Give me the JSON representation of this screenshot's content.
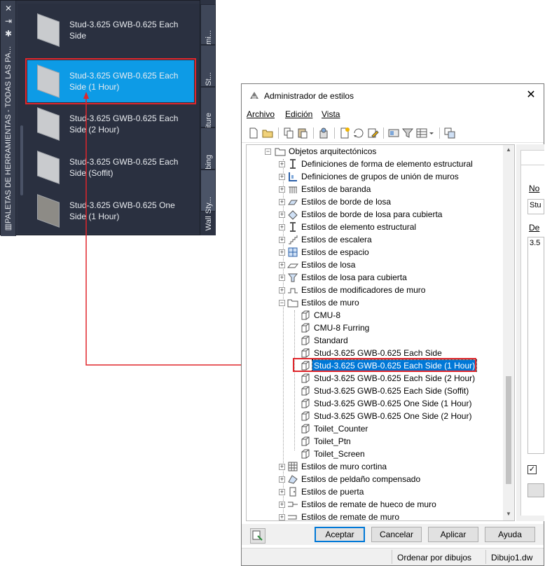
{
  "palette": {
    "title": "PALETAS DE HERRAMIENTAS - TODAS LAS PA...",
    "controls": [
      "close-icon",
      "autohide-icon",
      "properties-icon"
    ],
    "items": [
      {
        "label_line1": "Stud-3.625 GWB-0.625 Each",
        "label_line2": "Side"
      },
      {
        "label_line1": "Stud-3.625 GWB-0.625 Each",
        "label_line2": "Side (1 Hour)"
      },
      {
        "label_line1": "Stud-3.625 GWB-0.625 Each",
        "label_line2": "Side (2 Hour)"
      },
      {
        "label_line1": "Stud-3.625 GWB-0.625 Each",
        "label_line2": "Side (Soffit)"
      },
      {
        "label_line1": "Stud-3.625 GWB-0.625 One",
        "label_line2": "Side (1 Hour)"
      }
    ],
    "selected_index": 1,
    "tabs": [
      "Herrami...",
      "Door St...",
      "Furniture",
      "Plumbing",
      "Wall Sty..."
    ]
  },
  "dialog": {
    "title": "Administrador de estilos",
    "close_glyph": "✕",
    "menu": [
      "Archivo",
      "Edición",
      "Vista"
    ],
    "tree": {
      "root": "Objetos arquitectónicos",
      "categories": [
        "Definiciones de forma de elemento estructural",
        "Definiciones de grupos de unión de muros",
        "Estilos de baranda",
        "Estilos de borde de losa",
        "Estilos de borde de losa para cubierta",
        "Estilos de elemento estructural",
        "Estilos de escalera",
        "Estilos de espacio",
        "Estilos de losa",
        "Estilos de losa para cubierta",
        "Estilos de modificadores de muro",
        "Estilos de muro"
      ],
      "wall_styles": [
        "CMU-8",
        "CMU-8 Furring",
        "Standard",
        "Stud-3.625 GWB-0.625 Each Side",
        "Stud-3.625 GWB-0.625 Each Side (1 Hour)",
        "Stud-3.625 GWB-0.625 Each Side (2 Hour)",
        "Stud-3.625 GWB-0.625 Each Side (Soffit)",
        "Stud-3.625 GWB-0.625 One Side (1 Hour)",
        "Stud-3.625 GWB-0.625 One Side (2 Hour)",
        "Toilet_Counter",
        "Toilet_Ptn",
        "Toilet_Screen"
      ],
      "selected_wall_style_index": 4,
      "after_categories": [
        "Estilos de muro cortina",
        "Estilos de peldaño compensado",
        "Estilos de puerta",
        "Estilos de remate de hueco de muro",
        "Estilos de remate de muro"
      ]
    },
    "right_pane": {
      "name_label": "No",
      "name_value": "Stu",
      "desc_label": "De",
      "desc_value": "3.5",
      "checkbox": "✓"
    },
    "buttons": {
      "ok": "Aceptar",
      "cancel": "Cancelar",
      "apply": "Aplicar",
      "help": "Ayuda"
    },
    "status": {
      "sort": "Ordenar por dibujos",
      "drawing": "Dibujo1.dw"
    }
  },
  "colors": {
    "palette_bg": "#2d3343",
    "palette_selected": "#0d9be6",
    "highlight_frame": "#e0262b",
    "tree_selected": "#0078d7"
  }
}
